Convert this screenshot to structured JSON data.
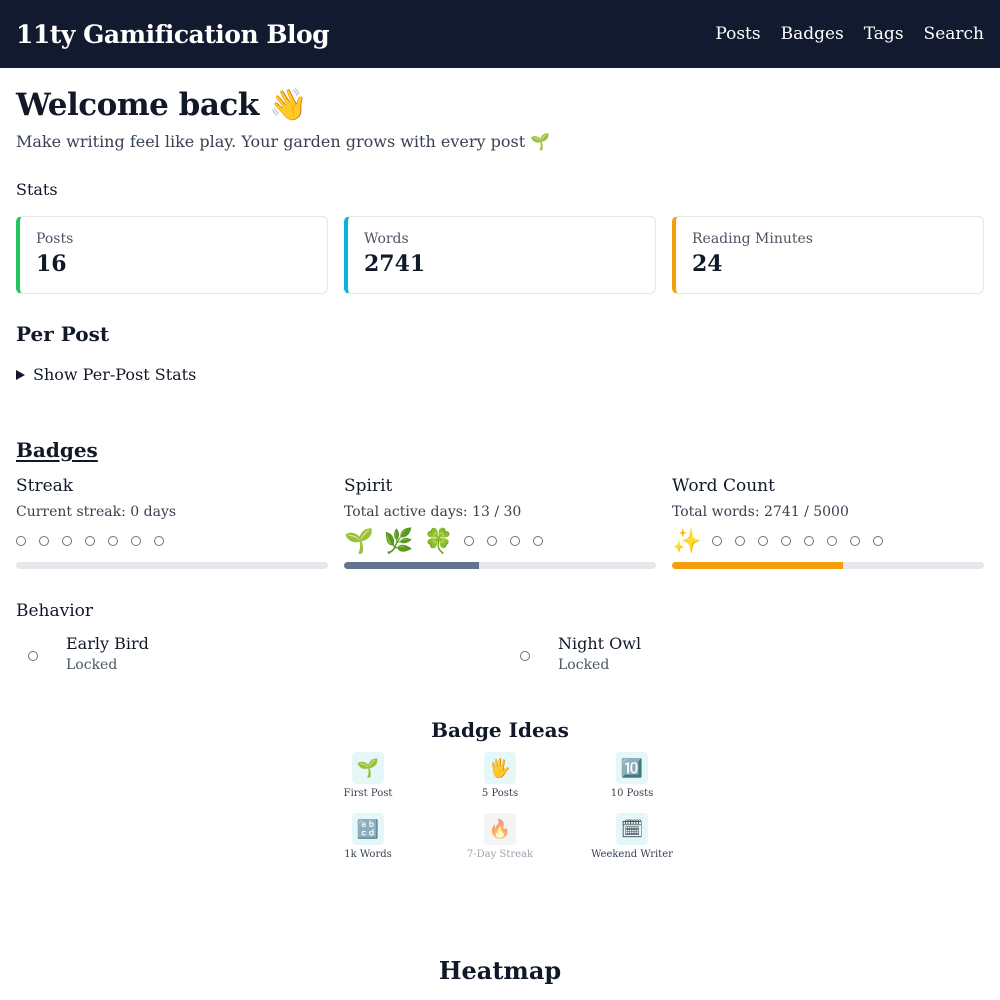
{
  "header": {
    "site_title": "11ty Gamification Blog",
    "nav": [
      {
        "label": "Posts"
      },
      {
        "label": "Badges"
      },
      {
        "label": "Tags"
      },
      {
        "label": "Search"
      }
    ]
  },
  "welcome": {
    "title": "Welcome back 👋",
    "subtitle": "Make writing feel like play. Your garden grows with every post 🌱"
  },
  "stats": {
    "label": "Stats",
    "cards": [
      {
        "label": "Posts",
        "value": "16",
        "accent": "#22c55e"
      },
      {
        "label": "Words",
        "value": "2741",
        "accent": "#06b6d4"
      },
      {
        "label": "Reading Minutes",
        "value": "24",
        "accent": "#f59e0b"
      }
    ]
  },
  "per_post": {
    "heading": "Per Post",
    "toggle_label": "Show Per-Post Stats"
  },
  "badges": {
    "heading": "Badges",
    "streak": {
      "title": "Streak",
      "subtitle": "Current streak: 0 days",
      "emojis": [],
      "empty_slots": 7,
      "progress": 0,
      "bar_color": "#64748b"
    },
    "spirit": {
      "title": "Spirit",
      "subtitle": "Total active days: 13 / 30",
      "emojis": [
        "🌱",
        "🌿",
        "🍀"
      ],
      "empty_slots": 4,
      "progress": 0.433,
      "bar_color": "#64748b"
    },
    "word_count": {
      "title": "Word Count",
      "subtitle": "Total words: 2741 / 5000",
      "emojis": [
        "✨"
      ],
      "empty_slots": 8,
      "progress": 0.548,
      "bar_color": "#f59e0b"
    },
    "behavior": {
      "heading": "Behavior",
      "items": [
        {
          "name": "Early Bird",
          "status": "Locked"
        },
        {
          "name": "Night Owl",
          "status": "Locked"
        }
      ]
    }
  },
  "badge_ideas": {
    "heading": "Badge Ideas",
    "items": [
      {
        "icon": "🌱",
        "label": "First Post",
        "locked": false
      },
      {
        "icon": "🖐",
        "label": "5 Posts",
        "locked": false
      },
      {
        "icon": "🔟",
        "label": "10 Posts",
        "locked": false
      },
      {
        "icon": "🔡",
        "label": "1k Words",
        "locked": false
      },
      {
        "icon": "🔥",
        "label": "7-Day Streak",
        "locked": true
      },
      {
        "icon": "🗓",
        "label": "Weekend Writer",
        "locked": false
      }
    ]
  },
  "heatmap": {
    "heading": "Heatmap"
  }
}
